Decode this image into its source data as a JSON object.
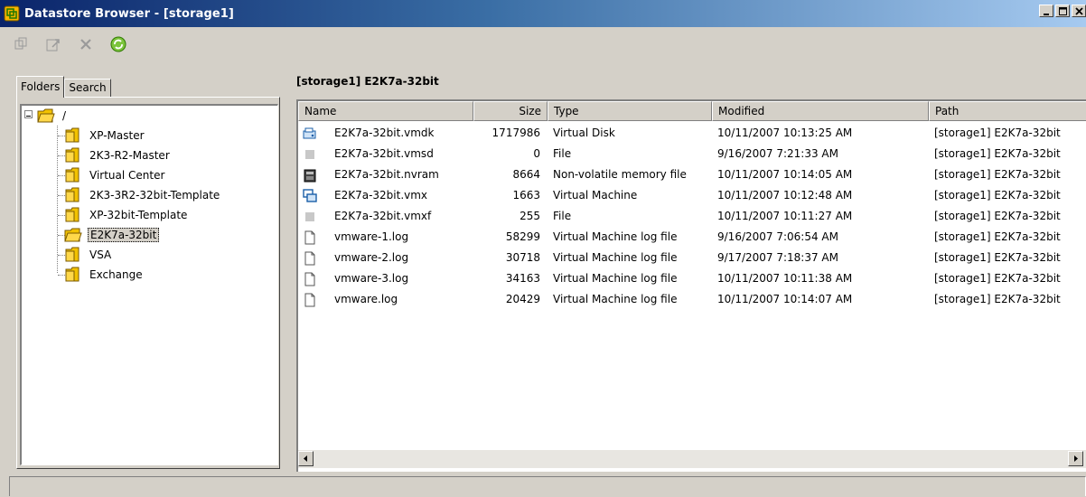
{
  "window": {
    "title": "Datastore Browser - [storage1]"
  },
  "toolbar": {
    "buttons": [
      {
        "icon": "new-folder-icon"
      },
      {
        "icon": "upload-icon"
      },
      {
        "icon": "delete-icon"
      },
      {
        "icon": "refresh-icon"
      }
    ]
  },
  "tabs": {
    "folders": "Folders",
    "search": "Search"
  },
  "tree": {
    "root": "/",
    "items": [
      "XP-Master",
      "2K3-R2-Master",
      "Virtual Center",
      "2K3-3R2-32bit-Template",
      "XP-32bit-Template",
      "E2K7a-32bit",
      "VSA",
      "Exchange"
    ],
    "selected": "E2K7a-32bit"
  },
  "main": {
    "path": "[storage1] E2K7a-32bit",
    "columns": {
      "name": "Name",
      "size": "Size",
      "type": "Type",
      "modified": "Modified",
      "path": "Path"
    },
    "rows": [
      {
        "icon": "virtual-disk-icon",
        "name": "E2K7a-32bit.vmdk",
        "size": "1717986",
        "type": "Virtual Disk",
        "modified": "10/11/2007 10:13:25 AM",
        "path": "[storage1] E2K7a-32bit"
      },
      {
        "icon": "file-icon",
        "name": "E2K7a-32bit.vmsd",
        "size": "0",
        "type": "File",
        "modified": "9/16/2007 7:21:33 AM",
        "path": "[storage1] E2K7a-32bit"
      },
      {
        "icon": "nvram-icon",
        "name": "E2K7a-32bit.nvram",
        "size": "8664",
        "type": "Non-volatile memory file",
        "modified": "10/11/2007 10:14:05 AM",
        "path": "[storage1] E2K7a-32bit"
      },
      {
        "icon": "virtual-machine-icon",
        "name": "E2K7a-32bit.vmx",
        "size": "1663",
        "type": "Virtual Machine",
        "modified": "10/11/2007 10:12:48 AM",
        "path": "[storage1] E2K7a-32bit"
      },
      {
        "icon": "file-icon",
        "name": "E2K7a-32bit.vmxf",
        "size": "255",
        "type": "File",
        "modified": "10/11/2007 10:11:27 AM",
        "path": "[storage1] E2K7a-32bit"
      },
      {
        "icon": "log-file-icon",
        "name": "vmware-1.log",
        "size": "58299",
        "type": "Virtual Machine log file",
        "modified": "9/16/2007 7:06:54 AM",
        "path": "[storage1] E2K7a-32bit"
      },
      {
        "icon": "log-file-icon",
        "name": "vmware-2.log",
        "size": "30718",
        "type": "Virtual Machine log file",
        "modified": "9/17/2007 7:18:37 AM",
        "path": "[storage1] E2K7a-32bit"
      },
      {
        "icon": "log-file-icon",
        "name": "vmware-3.log",
        "size": "34163",
        "type": "Virtual Machine log file",
        "modified": "10/11/2007 10:11:38 AM",
        "path": "[storage1] E2K7a-32bit"
      },
      {
        "icon": "log-file-icon",
        "name": "vmware.log",
        "size": "20429",
        "type": "Virtual Machine log file",
        "modified": "10/11/2007 10:14:07 AM",
        "path": "[storage1] E2K7a-32bit"
      }
    ]
  },
  "colors": {
    "titlebar_start": "#0a246a",
    "titlebar_end": "#a6caf0",
    "chrome": "#d4d0c8",
    "folder": "#f2c200"
  }
}
